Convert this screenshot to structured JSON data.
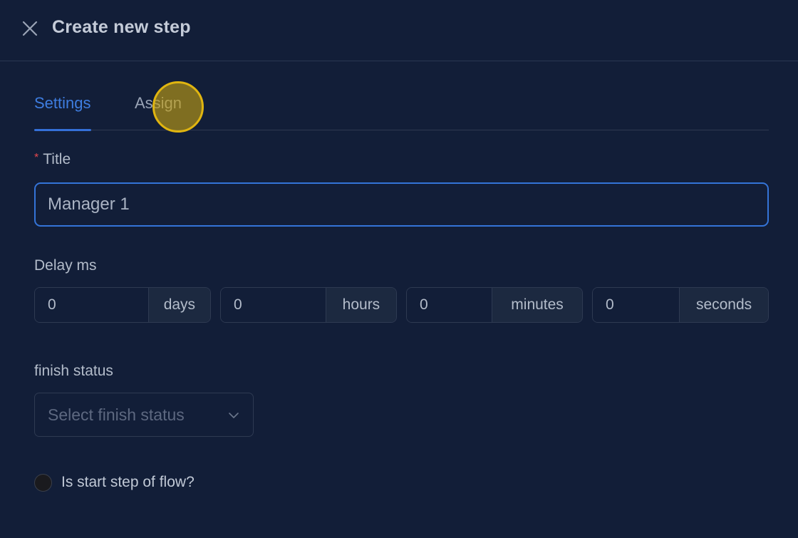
{
  "header": {
    "title": "Create new step",
    "close_icon": "close-icon"
  },
  "tabs": [
    {
      "label": "Settings",
      "active": true
    },
    {
      "label": "Assign",
      "active": false
    }
  ],
  "form": {
    "title": {
      "label": "Title",
      "required": true,
      "value": "Manager 1"
    },
    "delay": {
      "label": "Delay ms",
      "fields": [
        {
          "value": "0",
          "unit": "days"
        },
        {
          "value": "0",
          "unit": "hours"
        },
        {
          "value": "0",
          "unit": "minutes"
        },
        {
          "value": "0",
          "unit": "seconds"
        }
      ]
    },
    "finish_status": {
      "label": "finish status",
      "placeholder": "Select finish status"
    },
    "start_step": {
      "label": "Is start step of flow?",
      "checked": false
    }
  },
  "colors": {
    "background": "#121e38",
    "accent": "#3474d8",
    "required": "#e5484d",
    "click_marker": "#e0b510"
  }
}
